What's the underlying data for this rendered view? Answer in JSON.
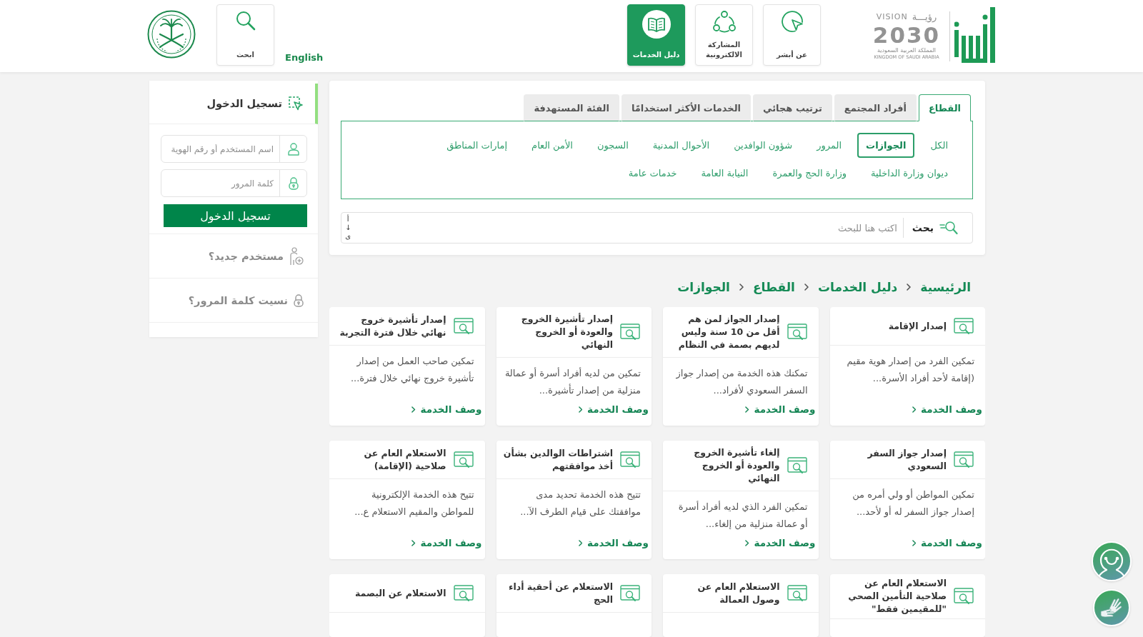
{
  "header": {
    "vision_logo": {
      "arabic": "رؤيـــة",
      "latin": "VISION",
      "year": "2030",
      "country_ar": "المملكة العربية السعودية",
      "country_en": "KINGDOM OF SAUDI ARABIA"
    },
    "nav": [
      {
        "label": "عن أبشر",
        "selected": false
      },
      {
        "label": "المشاركة الالكترونية",
        "selected": false
      },
      {
        "label": "دليل الخدمات",
        "selected": true
      }
    ],
    "language_link": "English",
    "search_tile": "ابحث"
  },
  "tabs": [
    {
      "label": "القطاع",
      "selected": true
    },
    {
      "label": "أفراد المجتمع",
      "selected": false
    },
    {
      "label": "ترتيب هجائي",
      "selected": false
    },
    {
      "label": "الخدمات الأكثر استخدامًا",
      "selected": false
    },
    {
      "label": "الفئة المستهدفة",
      "selected": false
    }
  ],
  "sector_rows": [
    [
      {
        "label": "الكل",
        "selected": false
      },
      {
        "label": "الجوازات",
        "selected": true
      },
      {
        "label": "المرور",
        "selected": false
      },
      {
        "label": "شؤون الوافدين",
        "selected": false
      },
      {
        "label": "الأحوال المدنية",
        "selected": false
      },
      {
        "label": "السجون",
        "selected": false
      },
      {
        "label": "الأمن العام",
        "selected": false
      },
      {
        "label": "إمارات المناطق",
        "selected": false
      }
    ],
    [
      {
        "label": "ديوان وزارة الداخلية",
        "selected": false
      },
      {
        "label": "وزارة الحج والعمرة",
        "selected": false
      },
      {
        "label": "النيابة العامة",
        "selected": false
      },
      {
        "label": "خدمات عامة",
        "selected": false
      }
    ]
  ],
  "search": {
    "label": "بحث",
    "placeholder": "اكتب هنا للبحث",
    "sort_glyphs": [
      "أ",
      "↓",
      "ى"
    ]
  },
  "breadcrumb": [
    "الرئيسية",
    "دليل الخدمات",
    "القطاع",
    "الجوازات"
  ],
  "services": [
    {
      "title": "إصدار الإقامة",
      "description": "تمكين الفرد من إصدار هوية مقيم (إقامة لأحد أفراد الأسرة...",
      "link": "وصف الخدمة"
    },
    {
      "title": "إصدار الجواز لمن هم أقل من 10 سنة وليس لديهم بصمة في النظام",
      "description": "تمكنك هذه الخدمة من إصدار جواز السفر السعودي لأفراد...",
      "link": "وصف الخدمة"
    },
    {
      "title": "إصدار تأشيرة الخروج والعودة أو الخروج النهائي",
      "description": "تمكين من لديه أفراد أسرة أو عمالة منزلية من إصدار تأشيرة...",
      "link": "وصف الخدمة"
    },
    {
      "title": "إصدار تأشيرة خروج نهائي خلال فترة التجربة",
      "description": "تمكين صاحب العمل من إصدار تأشيرة خروج نهائي خلال فترة...",
      "link": "وصف الخدمة"
    },
    {
      "title": "إصدار جواز السفر السعودي",
      "description": "تمكين المواطن أو ولي أمره من إصدار جواز السفر له أو لأحد...",
      "link": "وصف الخدمة"
    },
    {
      "title": "إلغاء تأشيرة الخروج والعودة أو الخروج النهائي",
      "description": "تمكين الفرد الذي لديه أفراد أسرة أو عمالة منزلية من إلغاء...",
      "link": "وصف الخدمة"
    },
    {
      "title": "اشتراطات الوالدين بشأن أخذ موافقتهم",
      "description": "تتيح هذه الخدمة تحديد مدى موافقتك على قيام الطرف الآ...",
      "link": "وصف الخدمة"
    },
    {
      "title": "الاستعلام العام عن صلاحية (الإقامة)",
      "description": "تتيح هذه الخدمة الإلكترونية للمواطن والمقيم الاستعلام ع...",
      "link": "وصف الخدمة"
    },
    {
      "title": "الاستعلام العام عن صلاحية التأمين الصحي \"للمقيمين فقط\""
    },
    {
      "title": "الاستعلام العام عن وصول العمالة"
    },
    {
      "title": "الاستعلام عن أحقية أداء الحج"
    },
    {
      "title": "الاستعلام عن البصمة"
    }
  ],
  "login": {
    "title": "تسجيل الدخول",
    "username_placeholder": "اسم المستخدم أو رقم الهوية",
    "password_placeholder": "كلمة المرور",
    "submit": "تسجيل الدخول",
    "links": [
      "مستخدم جديد؟",
      "نسيت كلمة المرور؟"
    ]
  }
}
